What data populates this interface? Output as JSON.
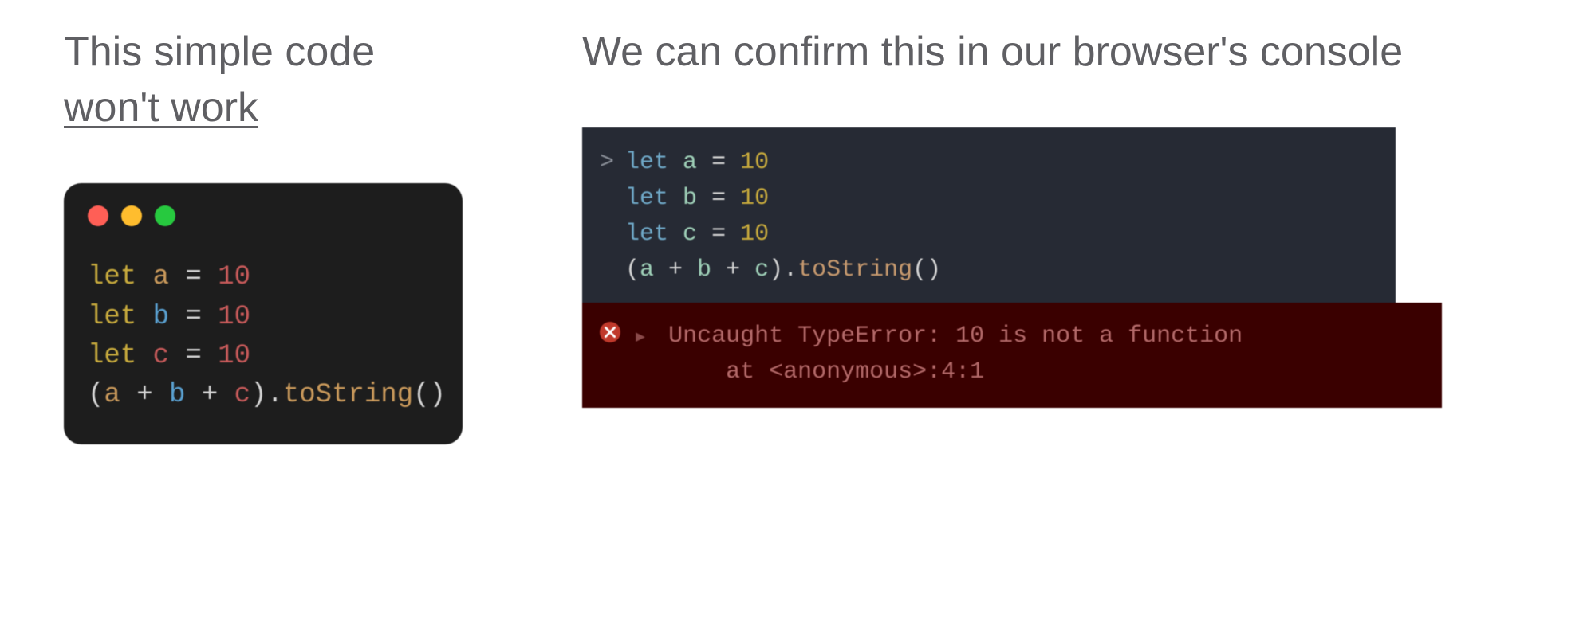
{
  "left": {
    "captionLine1": "This simple code",
    "captionLine2": "won't work",
    "code": {
      "l1": {
        "kw": "let",
        "id": "a",
        "eq": "=",
        "num": "10"
      },
      "l2": {
        "kw": "let",
        "id": "b",
        "eq": "=",
        "num": "10"
      },
      "l3": {
        "kw": "let",
        "id": "c",
        "eq": "=",
        "num": "10"
      },
      "l4": {
        "lp": "(",
        "a": "a",
        "p1": " + ",
        "b": "b",
        "p2": " + ",
        "c": "c",
        "rp": ")",
        "dot": ".",
        "fn": "toString",
        "call": "()"
      }
    }
  },
  "right": {
    "caption": "We can confirm this in our browser's console",
    "prompt": ">",
    "input": {
      "l1": {
        "kw": "let",
        "id": "a",
        "eq": "=",
        "num": "10"
      },
      "l2": {
        "kw": "let",
        "id": "b",
        "eq": "=",
        "num": "10"
      },
      "l3": {
        "kw": "let",
        "id": "c",
        "eq": "=",
        "num": "10"
      },
      "l4": {
        "lp": "(",
        "a": "a",
        "p1": " + ",
        "b": "b",
        "p2": " + ",
        "c": "c",
        "rp": ")",
        "dot": ".",
        "fn": "toString",
        "call": "()"
      }
    },
    "error": {
      "caret": "▸",
      "line1": "Uncaught TypeError: 10 is not a function",
      "line2": "    at <anonymous>:4:1"
    }
  }
}
